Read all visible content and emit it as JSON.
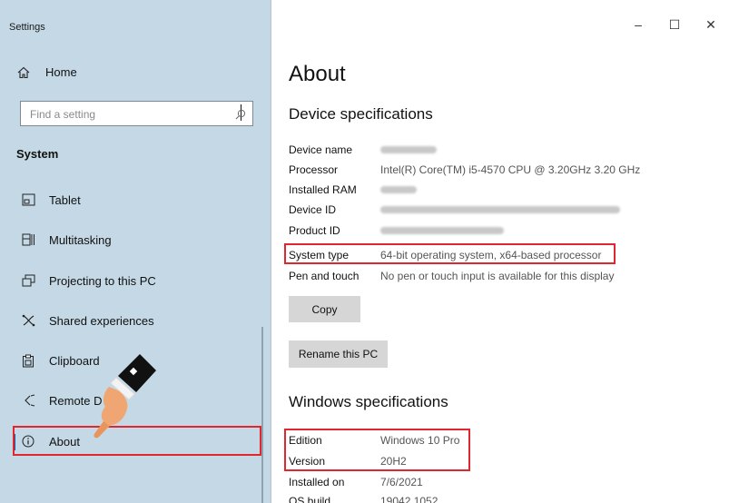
{
  "window": {
    "app_title": "Settings",
    "controls": {
      "minimize": "–",
      "maximize": "☐",
      "close": "✕"
    }
  },
  "sidebar": {
    "home_label": "Home",
    "search": {
      "placeholder": "Find a setting",
      "value": ""
    },
    "section_title": "System",
    "items": [
      {
        "label": "Tablet",
        "icon": "tablet-icon"
      },
      {
        "label": "Multitasking",
        "icon": "multitasking-icon"
      },
      {
        "label": "Projecting to this PC",
        "icon": "projecting-icon"
      },
      {
        "label": "Shared experiences",
        "icon": "shared-experiences-icon"
      },
      {
        "label": "Clipboard",
        "icon": "clipboard-icon"
      },
      {
        "label": "Remote D",
        "icon": "remote-desktop-icon"
      },
      {
        "label": "About",
        "icon": "info-icon"
      }
    ],
    "selected": "About"
  },
  "main": {
    "title": "About",
    "device_specs": {
      "heading": "Device specifications",
      "rows": [
        {
          "label": "Device name",
          "value": "",
          "blurred": true
        },
        {
          "label": "Processor",
          "value": "Intel(R) Core(TM) i5-4570 CPU @ 3.20GHz   3.20 GHz",
          "blurred": false
        },
        {
          "label": "Installed RAM",
          "value": "",
          "blurred": true
        },
        {
          "label": "Device ID",
          "value": "",
          "blurred": true
        },
        {
          "label": "Product ID",
          "value": "",
          "blurred": true
        },
        {
          "label": "System type",
          "value": "64-bit operating system, x64-based processor",
          "blurred": false
        },
        {
          "label": "Pen and touch",
          "value": "No pen or touch input is available for this display",
          "blurred": false
        }
      ],
      "copy_button": "Copy",
      "rename_button": "Rename this PC"
    },
    "windows_specs": {
      "heading": "Windows specifications",
      "rows": [
        {
          "label": "Edition",
          "value": "Windows 10 Pro"
        },
        {
          "label": "Version",
          "value": "20H2"
        },
        {
          "label": "Installed on",
          "value": "7/6/2021"
        },
        {
          "label": "OS build",
          "value": "19042.1052"
        }
      ]
    }
  },
  "colors": {
    "sidebar_bg": "#c4d8e5",
    "highlight_red": "#e0262e",
    "accent": "#0063b1"
  }
}
